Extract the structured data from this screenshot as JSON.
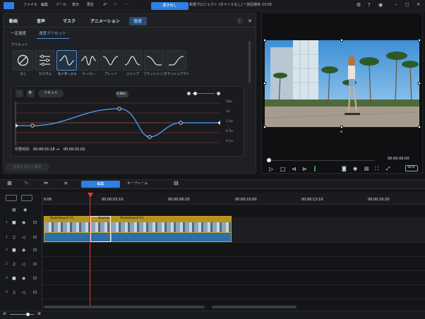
{
  "titlebar": {
    "menus": [
      "ファイル",
      "編集",
      "ツール",
      "表示",
      "再生"
    ],
    "export_label": "書き出し",
    "title": "新規プロジェクト (タイトルなし) * 前回保存 23:05"
  },
  "tabs": [
    "動画",
    "音声",
    "マスク",
    "アニメーション",
    "速度"
  ],
  "subtabs": [
    "一定速度",
    "速度プリセット"
  ],
  "presets_label": "プリセット",
  "presets": [
    "なし",
    "カスタム",
    "モンタージュ",
    "ヒーロー",
    "ブレット",
    "ジャンプ",
    "フラッシュイン",
    "フラッシュアウト"
  ],
  "editor": {
    "reset_label": "リセット",
    "speed_badge": "0.89x",
    "speed_ticks": [
      "10x",
      "5x",
      "1.0x",
      "0.5x",
      "0.1x"
    ],
    "duration_label": "所要時間:",
    "duration_from": "00:00:01:18",
    "duration_to": "00:00:01:02"
  },
  "save_preset_label": "名前を付けて保存",
  "preview": {
    "timecode": "00:00:00:00",
    "ratio": "16:9"
  },
  "tool_tabs": {
    "edit": "編集",
    "keyframe": "キーフレーム"
  },
  "ruler": [
    "0:00",
    "00:00:03:10",
    "00:00:06:20",
    "00:00:10:00",
    "00:00:13:10",
    "00:00:16:20"
  ],
  "clips": [
    "Skateboard 01",
    "Skateb",
    "Skateboard 01"
  ],
  "tracks": [
    "1",
    "1",
    "2",
    "2",
    "3",
    "3"
  ],
  "colors": {
    "accent": "#2f7fe6",
    "playhead": "#e53935",
    "clip": "#c9a227"
  }
}
